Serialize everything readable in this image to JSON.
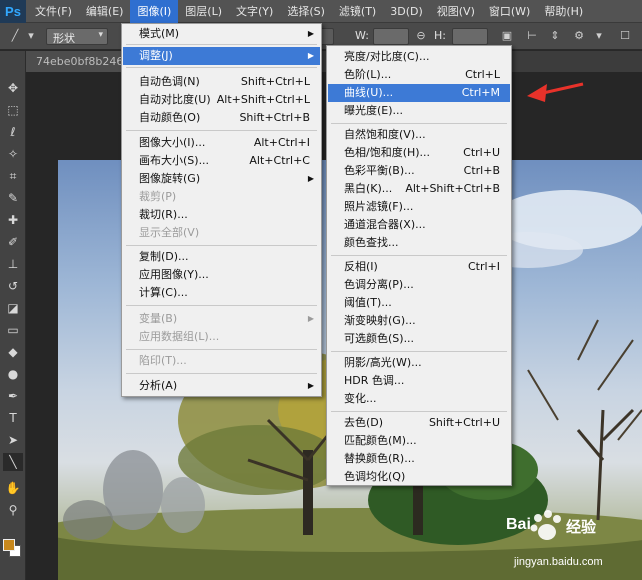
{
  "app": {
    "logo": "Ps"
  },
  "menubar": {
    "items": [
      "文件(F)",
      "编辑(E)",
      "图像(I)",
      "图层(L)",
      "文字(Y)",
      "选择(S)",
      "滤镜(T)",
      "3D(D)",
      "视图(V)",
      "窗口(W)",
      "帮助(H)"
    ],
    "active_index": 2
  },
  "options_bar": {
    "shape_mode": "形状",
    "w_label": "W:",
    "h_label": "H:"
  },
  "document_tab": {
    "title": "74ebe0bf8b24692"
  },
  "image_menu": {
    "items": [
      {
        "label": "模式(M)",
        "shortcut": "",
        "submenu": true,
        "disabled": false
      },
      {
        "label": "调整(J)",
        "shortcut": "",
        "submenu": true,
        "disabled": false,
        "highlight": true
      },
      {
        "label": "自动色调(N)",
        "shortcut": "Shift+Ctrl+L",
        "disabled": false
      },
      {
        "label": "自动对比度(U)",
        "shortcut": "Alt+Shift+Ctrl+L",
        "disabled": false
      },
      {
        "label": "自动颜色(O)",
        "shortcut": "Shift+Ctrl+B",
        "disabled": false
      },
      {
        "label": "图像大小(I)...",
        "shortcut": "Alt+Ctrl+I",
        "disabled": false
      },
      {
        "label": "画布大小(S)...",
        "shortcut": "Alt+Ctrl+C",
        "disabled": false
      },
      {
        "label": "图像旋转(G)",
        "shortcut": "",
        "submenu": true,
        "disabled": false
      },
      {
        "label": "裁剪(P)",
        "shortcut": "",
        "disabled": true
      },
      {
        "label": "裁切(R)...",
        "shortcut": "",
        "disabled": false
      },
      {
        "label": "显示全部(V)",
        "shortcut": "",
        "disabled": true
      },
      {
        "label": "复制(D)...",
        "shortcut": "",
        "disabled": false
      },
      {
        "label": "应用图像(Y)...",
        "shortcut": "",
        "disabled": false
      },
      {
        "label": "计算(C)...",
        "shortcut": "",
        "disabled": false
      },
      {
        "label": "变量(B)",
        "shortcut": "",
        "submenu": true,
        "disabled": true
      },
      {
        "label": "应用数据组(L)...",
        "shortcut": "",
        "disabled": true
      },
      {
        "label": "陷印(T)...",
        "shortcut": "",
        "disabled": true
      },
      {
        "label": "分析(A)",
        "shortcut": "",
        "submenu": true,
        "disabled": false
      }
    ]
  },
  "adjust_menu": {
    "items": [
      {
        "label": "亮度/对比度(C)...",
        "shortcut": ""
      },
      {
        "label": "色阶(L)...",
        "shortcut": "Ctrl+L"
      },
      {
        "label": "曲线(U)...",
        "shortcut": "Ctrl+M",
        "highlight": true
      },
      {
        "label": "曝光度(E)...",
        "shortcut": ""
      },
      {
        "label": "自然饱和度(V)...",
        "shortcut": ""
      },
      {
        "label": "色相/饱和度(H)...",
        "shortcut": "Ctrl+U"
      },
      {
        "label": "色彩平衡(B)...",
        "shortcut": "Ctrl+B"
      },
      {
        "label": "黑白(K)...",
        "shortcut": "Alt+Shift+Ctrl+B"
      },
      {
        "label": "照片滤镜(F)...",
        "shortcut": ""
      },
      {
        "label": "通道混合器(X)...",
        "shortcut": ""
      },
      {
        "label": "颜色查找...",
        "shortcut": ""
      },
      {
        "label": "反相(I)",
        "shortcut": "Ctrl+I"
      },
      {
        "label": "色调分离(P)...",
        "shortcut": ""
      },
      {
        "label": "阈值(T)...",
        "shortcut": ""
      },
      {
        "label": "渐变映射(G)...",
        "shortcut": ""
      },
      {
        "label": "可选颜色(S)...",
        "shortcut": ""
      },
      {
        "label": "阴影/高光(W)...",
        "shortcut": ""
      },
      {
        "label": "HDR 色调...",
        "shortcut": ""
      },
      {
        "label": "变化...",
        "shortcut": ""
      },
      {
        "label": "去色(D)",
        "shortcut": "Shift+Ctrl+U"
      },
      {
        "label": "匹配颜色(M)...",
        "shortcut": ""
      },
      {
        "label": "替换颜色(R)...",
        "shortcut": ""
      },
      {
        "label": "色调均化(Q)",
        "shortcut": ""
      }
    ]
  },
  "watermark": {
    "brand": "Bai",
    "brand2": "经验",
    "url": "jingyan.baidu.com"
  },
  "colors": {
    "accent": "#3d7ad6",
    "foreground_swatch": "#c8881c",
    "background_swatch": "#ffffff",
    "annotation_arrow": "#e8322a"
  },
  "icons": [
    "ps-logo",
    "move-icon",
    "marquee-icon",
    "lasso-icon",
    "magic-wand-icon",
    "crop-icon",
    "eyedropper-icon",
    "healing-brush-icon",
    "brush-icon",
    "clone-stamp-icon",
    "history-brush-icon",
    "eraser-icon",
    "gradient-icon",
    "blur-icon",
    "dodge-icon",
    "pen-icon",
    "type-icon",
    "path-selection-icon",
    "line-icon",
    "hand-icon",
    "zoom-icon",
    "gear-icon"
  ]
}
